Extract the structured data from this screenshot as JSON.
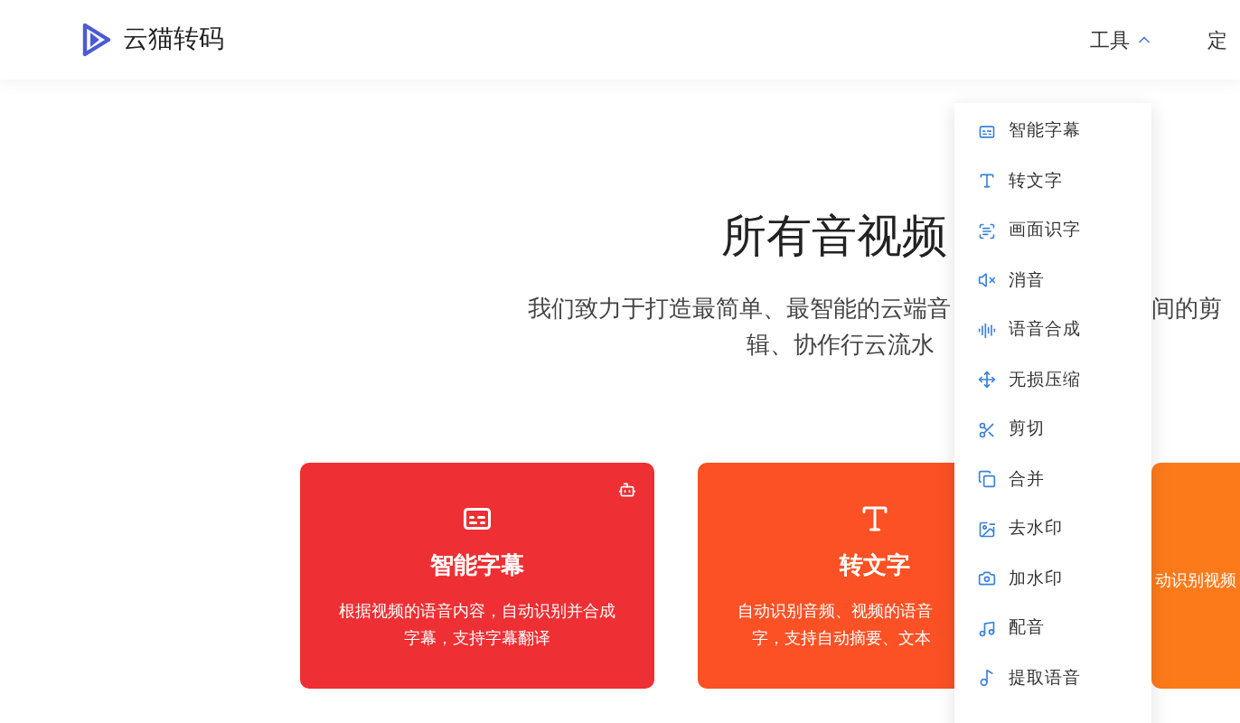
{
  "header": {
    "logo": "云猫转码",
    "nav": [
      {
        "label": "工具",
        "expanded": true
      },
      {
        "label": "定"
      }
    ]
  },
  "hero": {
    "title": "所有音视频",
    "subtitle_left": "我们致力于打造最简单、最智能的云端音",
    "subtitle_right": "间的剪",
    "subtitle_line2": "辑、协作行云流水"
  },
  "cards": [
    {
      "kind": "whole",
      "title": "智能字幕",
      "badge": true,
      "color": "#ee2f33",
      "lines": [
        "根据视频的语音内容，自动识别并合成",
        "字幕，支持字幕翻译"
      ]
    },
    {
      "kind": "partial",
      "title": "转文字",
      "badge": false,
      "color": "#fb5124",
      "lines": [
        "自动识别音频、视频的语音",
        "字，支持自动摘要、文本"
      ]
    },
    {
      "kind": "edge",
      "badge": false,
      "color": "#fd7a1b",
      "lines": [
        "动识别视频"
      ]
    }
  ],
  "menu": [
    {
      "label": "智能字幕"
    },
    {
      "label": "转文字"
    },
    {
      "label": "画面识字"
    },
    {
      "label": "消音"
    },
    {
      "label": "语音合成"
    },
    {
      "label": "无损压缩"
    },
    {
      "label": "剪切"
    },
    {
      "label": "合并"
    },
    {
      "label": "去水印"
    },
    {
      "label": "加水印"
    },
    {
      "label": "配音"
    },
    {
      "label": "提取语音"
    }
  ]
}
